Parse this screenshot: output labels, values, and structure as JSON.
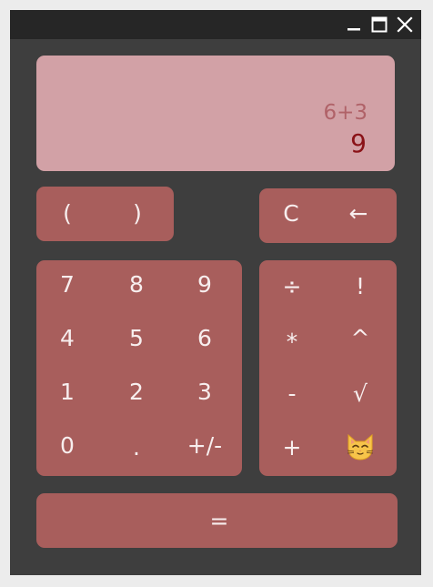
{
  "titlebar": {
    "minimize_icon": "minimize-icon",
    "maximize_icon": "maximize-icon",
    "close_icon": "close-icon"
  },
  "display": {
    "expression": "6+3",
    "result": "9"
  },
  "keys": {
    "paren_open": "(",
    "paren_close": ")",
    "clear": "C",
    "backspace": "←",
    "d7": "7",
    "d8": "8",
    "d9": "9",
    "d4": "4",
    "d5": "5",
    "d6": "6",
    "d1": "1",
    "d2": "2",
    "d3": "3",
    "d0": "0",
    "dot": ".",
    "negate": "+/-",
    "divide": "÷",
    "factorial": "!",
    "multiply": "*",
    "power": "^",
    "minus": "-",
    "sqrt": "√",
    "plus": "+",
    "equals": "="
  },
  "colors": {
    "window_bg": "#3e3e3e",
    "titlebar_bg": "#262626",
    "display_bg": "#d2a1a6",
    "expression_text": "#b06268",
    "result_text": "#8a1217",
    "key_bg": "#a85e5c",
    "key_text": "#f7eeee"
  }
}
